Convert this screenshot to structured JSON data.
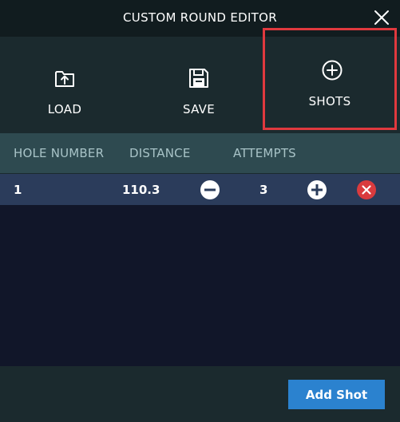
{
  "window": {
    "title": "CUSTOM ROUND EDITOR",
    "close_icon": "close-icon"
  },
  "toolbar": {
    "load_label": "LOAD",
    "save_label": "SAVE",
    "shots_label": "SHOTS"
  },
  "table": {
    "headers": [
      "HOLE NUMBER",
      "DISTANCE",
      "ATTEMPTS"
    ],
    "rows": [
      {
        "hole": "1",
        "distance": "110.3",
        "attempts": "3"
      }
    ]
  },
  "footer": {
    "add_shot_label": "Add Shot"
  },
  "colors": {
    "accent_blue": "#2b82cf",
    "delete_red": "#d93b3e",
    "highlight_border": "#e0393e"
  }
}
